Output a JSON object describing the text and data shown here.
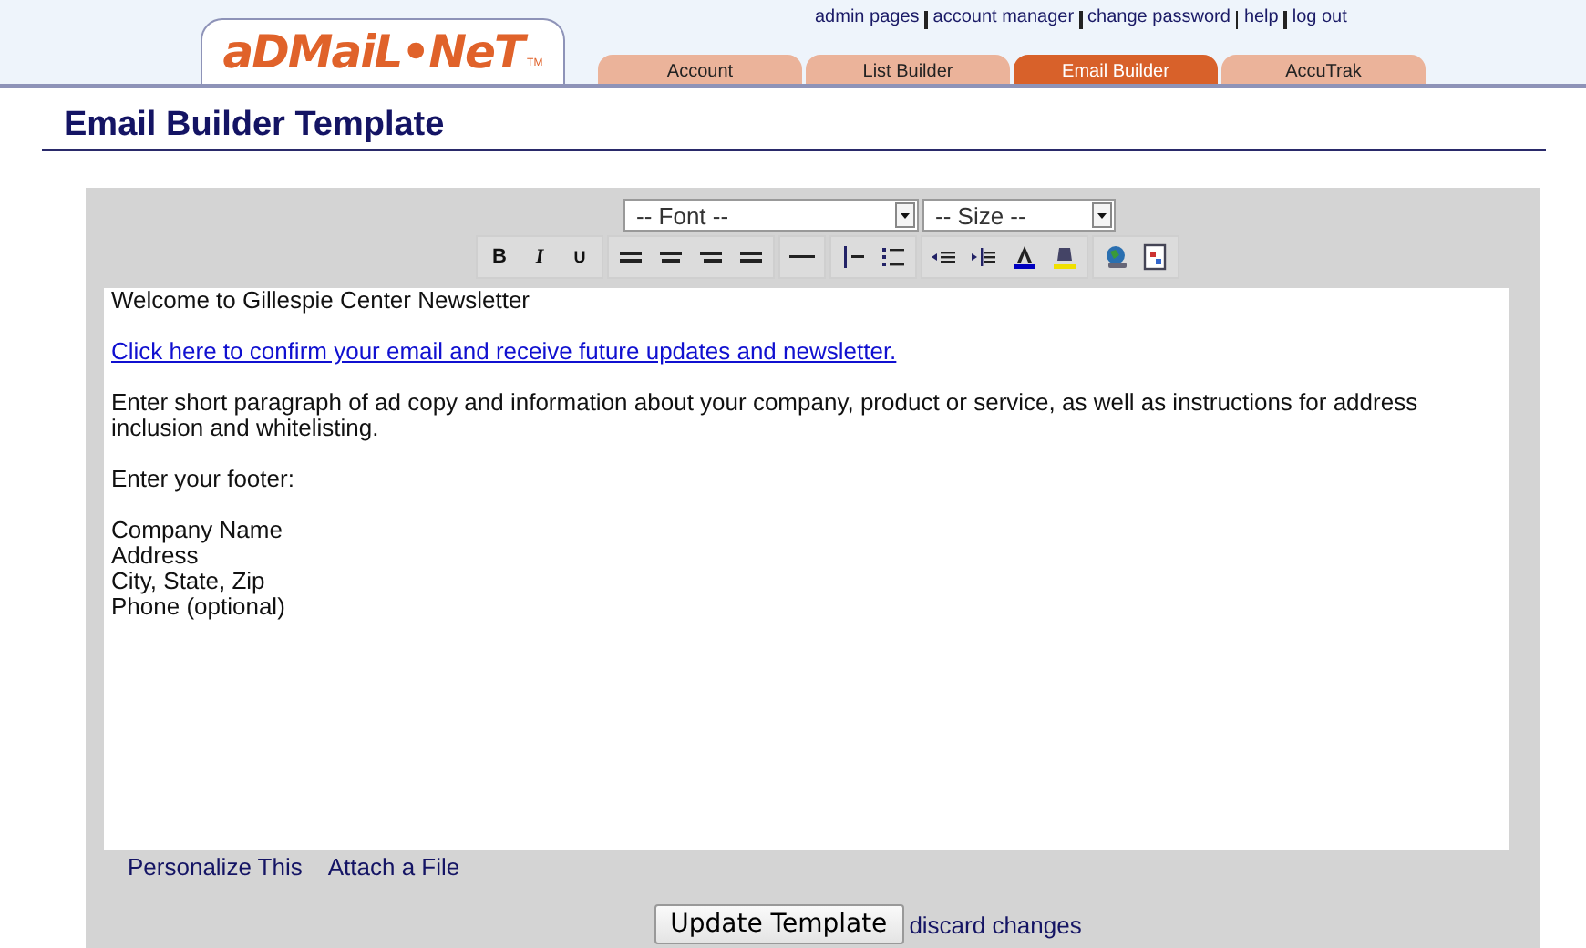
{
  "logo": {
    "text": "aDMaiL•NeT",
    "mark": "TM"
  },
  "top_links": [
    "admin pages",
    "account manager",
    "change password",
    "help",
    "log out"
  ],
  "tabs": [
    {
      "label": "Account",
      "selected": false
    },
    {
      "label": "List Builder",
      "selected": false
    },
    {
      "label": "Email Builder",
      "selected": true
    },
    {
      "label": "AccuTrak",
      "selected": false
    }
  ],
  "page_title": "Email Builder Template",
  "editor": {
    "font_select": "-- Font --",
    "size_select": "-- Size --",
    "toolbar": [
      [
        {
          "kind": "bold",
          "label": "B"
        },
        {
          "kind": "italic",
          "label": "I"
        },
        {
          "kind": "underline",
          "label": "U"
        }
      ],
      [
        {
          "kind": "align-left"
        },
        {
          "kind": "align-center"
        },
        {
          "kind": "align-right"
        },
        {
          "kind": "justify"
        }
      ],
      [
        {
          "kind": "rule"
        }
      ],
      [
        {
          "kind": "numbered-list"
        },
        {
          "kind": "bulleted-list"
        }
      ],
      [
        {
          "kind": "outdent"
        },
        {
          "kind": "indent"
        },
        {
          "kind": "text-color"
        },
        {
          "kind": "highlight"
        }
      ],
      [
        {
          "kind": "link"
        },
        {
          "kind": "image"
        }
      ]
    ],
    "content": [
      {
        "kind": "text",
        "lines": [
          "Welcome to Gillespie Center Newsletter"
        ]
      },
      {
        "kind": "link",
        "lines": [
          "Click here to confirm your email and receive future updates and newsletter."
        ]
      },
      {
        "kind": "text",
        "lines": [
          "Enter short paragraph of ad copy and information about your company, product or service, as well as instructions for address inclusion and whitelisting."
        ]
      },
      {
        "kind": "text",
        "lines": [
          "Enter your footer:"
        ]
      },
      {
        "kind": "text",
        "lines": [
          "Company Name",
          "Address",
          "City, State, Zip",
          "Phone (optional)"
        ]
      }
    ]
  },
  "editor_links": [
    "Personalize This",
    "Attach a File"
  ],
  "update_button": "Update Template",
  "discard_link": "discard changes"
}
